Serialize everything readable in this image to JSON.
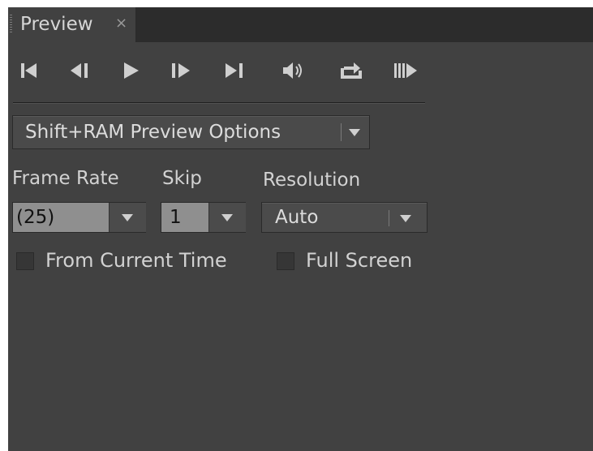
{
  "panel": {
    "tab_label": "Preview",
    "close_glyph": "×"
  },
  "transport": {
    "buttons": [
      {
        "name": "first-frame",
        "icon": "first-frame-icon"
      },
      {
        "name": "previous-frame",
        "icon": "previous-frame-icon"
      },
      {
        "name": "play",
        "icon": "play-icon"
      },
      {
        "name": "next-frame",
        "icon": "next-frame-icon"
      },
      {
        "name": "last-frame",
        "icon": "last-frame-icon"
      },
      {
        "name": "mute-audio",
        "icon": "speaker-icon"
      },
      {
        "name": "loop",
        "icon": "loop-icon"
      },
      {
        "name": "ram-preview",
        "icon": "ram-preview-icon"
      }
    ]
  },
  "options": {
    "selected": "Shift+RAM Preview Options"
  },
  "frame_rate": {
    "label": "Frame Rate",
    "value": "(25)"
  },
  "skip": {
    "label": "Skip",
    "value": "1"
  },
  "resolution": {
    "label": "Resolution",
    "value": "Auto"
  },
  "checkboxes": {
    "from_current_time": {
      "label": "From Current Time",
      "checked": false
    },
    "full_screen": {
      "label": "Full Screen",
      "checked": false
    }
  },
  "colors": {
    "panel_bg": "#414141",
    "tab_strip_bg": "#2c2c2c",
    "text": "#d2d2d2",
    "field_light_bg": "#8f8f8f"
  }
}
